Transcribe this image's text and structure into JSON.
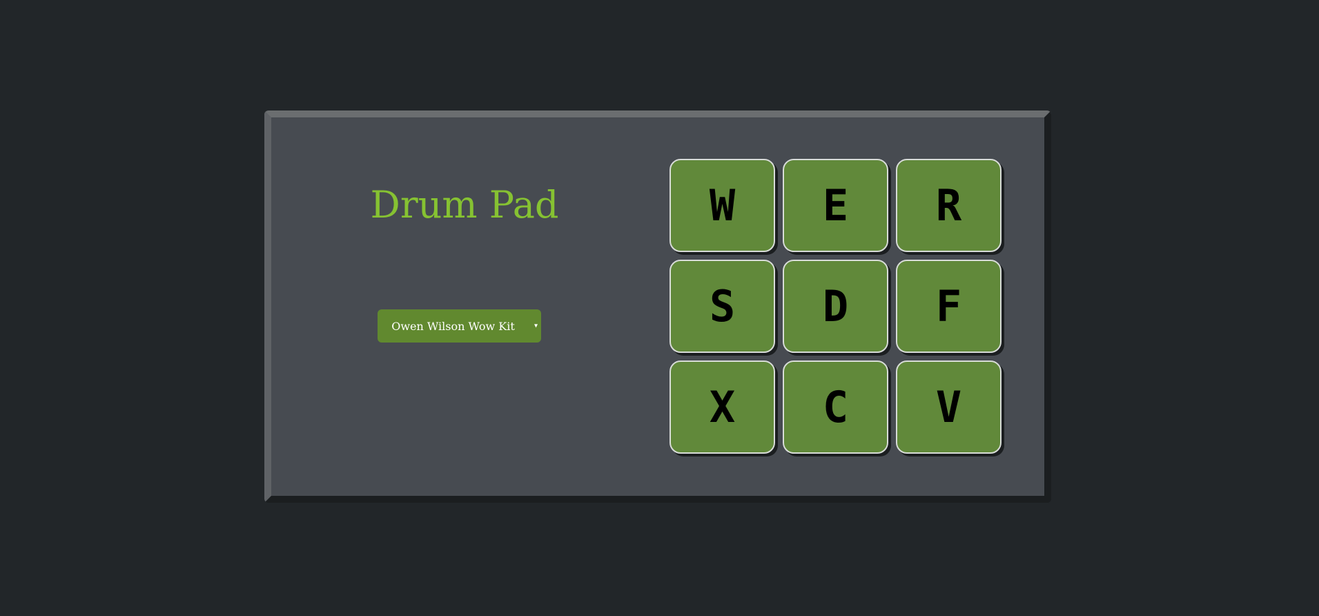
{
  "app": {
    "title": "Drum Pad"
  },
  "kit_selector": {
    "selected": "Owen Wilson Wow Kit",
    "arrow_icon": "dropdown-arrow-icon"
  },
  "pads": [
    {
      "key": "W"
    },
    {
      "key": "E"
    },
    {
      "key": "R"
    },
    {
      "key": "S"
    },
    {
      "key": "D"
    },
    {
      "key": "F"
    },
    {
      "key": "X"
    },
    {
      "key": "C"
    },
    {
      "key": "V"
    }
  ],
  "colors": {
    "page_background": "#222629",
    "panel_background": "#474b51",
    "accent_title": "#86c232",
    "pad_background": "#61893a",
    "select_background": "#61892f"
  }
}
